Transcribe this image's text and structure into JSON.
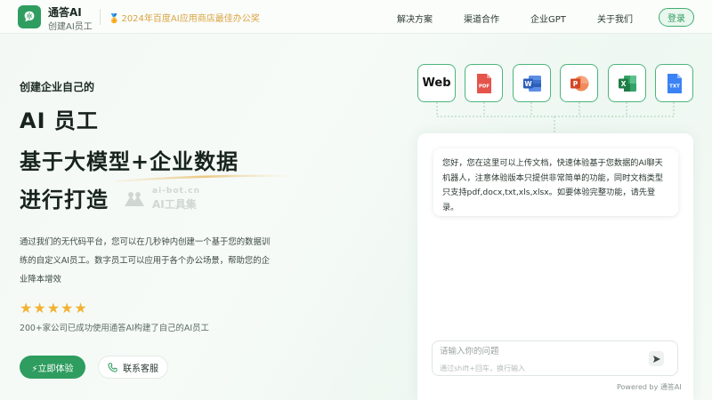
{
  "header": {
    "brand_name": "通答AI",
    "brand_sub": "创建AI员工",
    "award_text": "2024年百度AI应用商店最佳办公奖",
    "nav": [
      "解决方案",
      "渠道合作",
      "企业GPT",
      "关于我们"
    ],
    "login_label": "登录"
  },
  "hero": {
    "eyebrow": "创建企业自己的",
    "title_lines": [
      "AI 员工",
      "基于大模型+企业数据",
      "进行打造"
    ],
    "watermark_top": "ai-bot.cn",
    "watermark_bottom": "AI工具集",
    "description": "通过我们的无代码平台，您可以在几秒钟内创建一个基于您的数据训练的自定义AI员工。数字员工可以应用于各个办公场景，帮助您的企业降本增效",
    "stars": "★★★★★",
    "rating": 5,
    "social_proof": "200+家公司已成功使用通答AI构建了自己的AI员工",
    "primary_cta": "⚡立即体验",
    "secondary_cta": "联系客服"
  },
  "file_types": [
    {
      "label": "Web",
      "icon": "web-text"
    },
    {
      "label": "PDF",
      "icon": "pdf-file-icon",
      "color": "#e5534b"
    },
    {
      "label": "W",
      "icon": "word-file-icon",
      "color": "#2b5bb8"
    },
    {
      "label": "P",
      "icon": "powerpoint-file-icon",
      "color": "#d24726"
    },
    {
      "label": "X",
      "icon": "excel-file-icon",
      "color": "#1e7e45"
    },
    {
      "label": "TXT",
      "icon": "txt-file-icon",
      "color": "#3b82f6"
    }
  ],
  "chat": {
    "welcome_message": "您好，您在这里可以上传文档，快速体验基于您数据的AI聊天机器人，注意体验版本只提供非常简单的功能，同时文档类型只支持pdf,docx,txt,xls,xlsx。如要体验完整功能，请先登录。",
    "input_placeholder": "请输入你的问题",
    "input_value": "",
    "input_hint": "通过shift+回车，换行输入",
    "powered_by": "Powered by 通答AI"
  },
  "colors": {
    "brand_green": "#2e9d5f",
    "award_gold": "#d9a441",
    "star_gold": "#f2b233"
  }
}
